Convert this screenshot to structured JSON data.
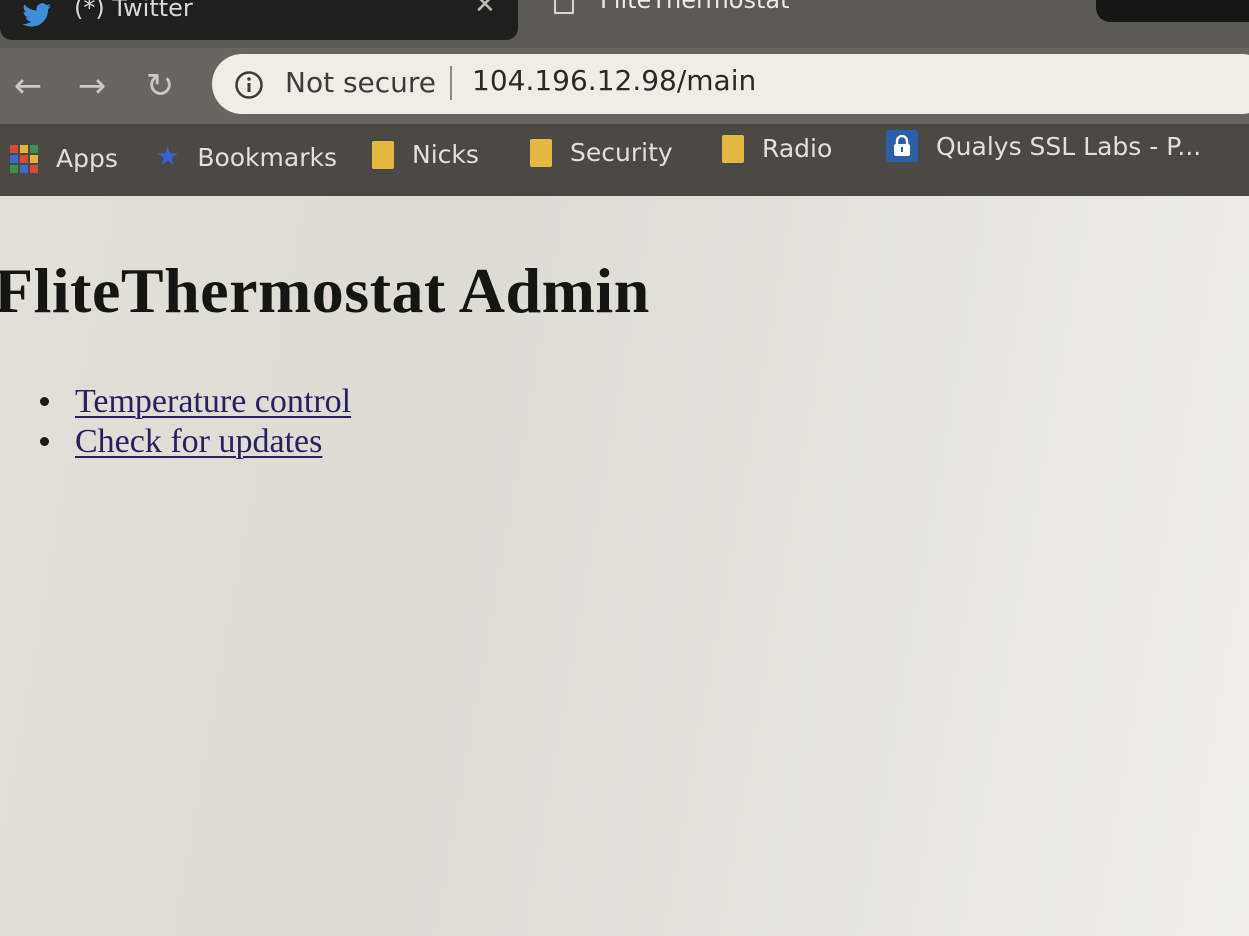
{
  "tabs": [
    {
      "title": "(*) Twitter",
      "icon": "twitter-bird-icon",
      "close": "✕"
    },
    {
      "title": "FliteThermostat",
      "icon": "page-icon"
    }
  ],
  "toolbar": {
    "back": "←",
    "forward": "→",
    "reload": "↻",
    "security_label": "Not secure",
    "url": "104.196.12.98/main"
  },
  "bookmarks": [
    {
      "label": "Apps",
      "icon": "apps-grid-icon"
    },
    {
      "label": "Bookmarks",
      "icon": "star-icon"
    },
    {
      "label": "Nicks",
      "icon": "folder-icon"
    },
    {
      "label": "Security",
      "icon": "folder-icon"
    },
    {
      "label": "Radio",
      "icon": "folder-icon"
    },
    {
      "label": "Qualys SSL Labs - P...",
      "icon": "lock-icon"
    }
  ],
  "page": {
    "title": "FliteThermostat Admin",
    "links": [
      {
        "label": "Temperature control"
      },
      {
        "label": "Check for updates"
      }
    ]
  },
  "colors": {
    "tab_strip": "#5b5a54",
    "toolbar": "#66655f",
    "bookmarks_bar": "#4a4944",
    "page_background": "#e2e0d8",
    "link": "#2a2060",
    "folder": "#e3b940"
  }
}
